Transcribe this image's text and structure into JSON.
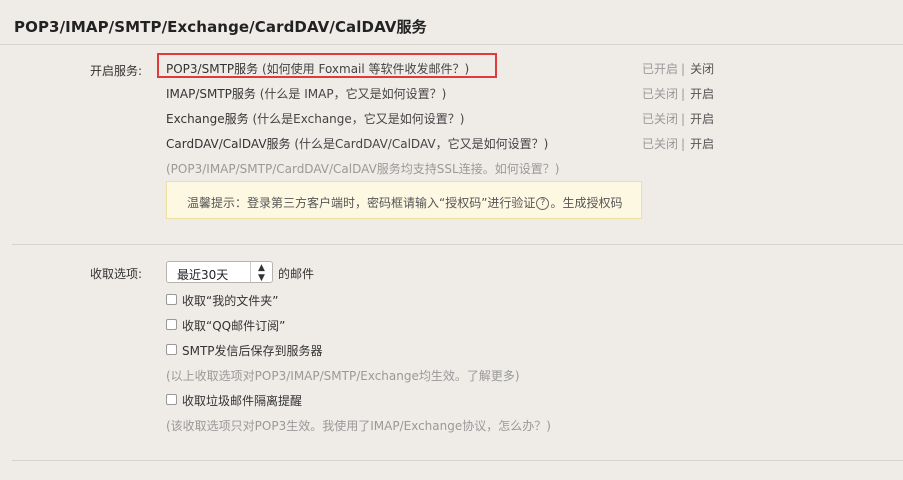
{
  "header": {
    "title": "POP3/IMAP/SMTP/Exchange/CardDAV/CalDAV服务"
  },
  "services": {
    "label": "开启服务:",
    "items": [
      {
        "name": "POP3/SMTP服务",
        "hint": "(如何使用 Foxmail 等软件收发邮件？)",
        "status": "已开启",
        "action": "关闭"
      },
      {
        "name": "IMAP/SMTP服务",
        "hint": "(什么是 IMAP，它又是如何设置？)",
        "status": "已关闭",
        "action": "开启"
      },
      {
        "name": "Exchange服务",
        "hint": "(什么是Exchange，它又是如何设置？)",
        "status": "已关闭",
        "action": "开启"
      },
      {
        "name": "CardDAV/CalDAV服务",
        "hint": "(什么是CardDAV/CalDAV，它又是如何设置？)",
        "status": "已关闭",
        "action": "开启"
      }
    ],
    "ssl_note": "(POP3/IMAP/SMTP/CardDAV/CalDAV服务均支持SSL连接。如何设置？)",
    "tip_prefix": "温馨提示：登录第三方客户端时，密码框请输入“授权码”进行验证",
    "tip_icon": "?",
    "tip_suffix": "。生成授权码"
  },
  "receive": {
    "label": "收取选项:",
    "select_value": "最近30天",
    "select_suffix": "的邮件",
    "options": [
      "收取“我的文件夹”",
      "收取“QQ邮件订阅”",
      "SMTP发信后保存到服务器"
    ],
    "note1": "(以上收取选项对POP3/IMAP/SMTP/Exchange均生效。了解更多)",
    "junk_option": "收取垃圾邮件隔离提醒",
    "note2": "(该收取选项只对POP3生效。我使用了IMAP/Exchange协议，怎么办？)"
  }
}
